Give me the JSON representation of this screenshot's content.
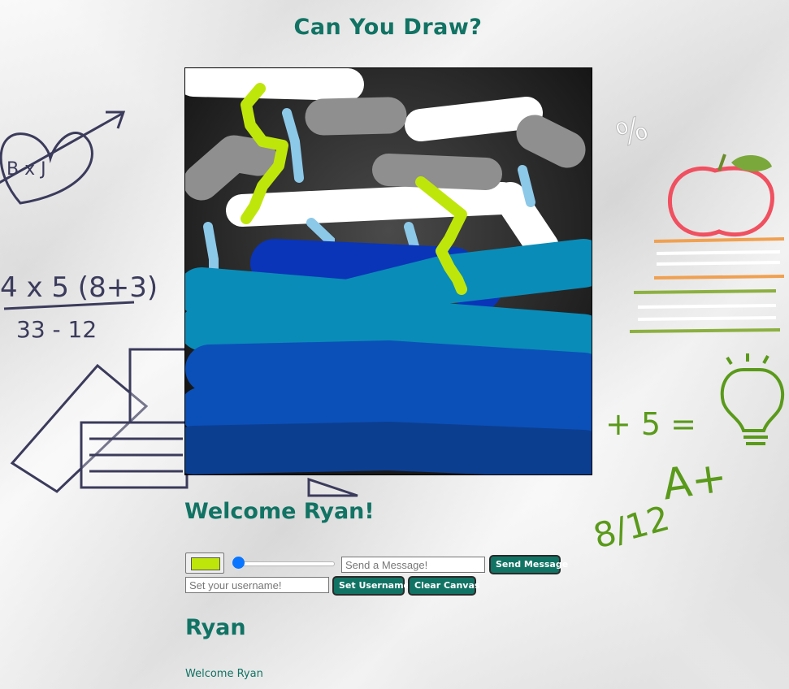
{
  "page": {
    "title": "Can You Draw?",
    "welcome_heading": "Welcome Ryan!",
    "username_heading": "Ryan"
  },
  "background": {
    "doodles": [
      "heart-doodle",
      "math-doodle",
      "books-doodle",
      "percent-doodle",
      "apple-doodle",
      "lightbulb-doodle",
      "grade-doodle"
    ],
    "heart_text": "B x J",
    "math_line1": "4 x 5 (8+3)",
    "math_line2": "33 - 12",
    "percent_text": "%",
    "equation_text": "+ 5 =",
    "grade_text": "A+",
    "fraction_text": "8/12"
  },
  "controls": {
    "brush_color": "#bfe60a",
    "brush_size_fraction": 0.05,
    "message_placeholder": "Send a Message!",
    "message_value": "",
    "send_message_label": "Send Message",
    "username_placeholder": "Set your username!",
    "username_value": "",
    "set_username_label": "Set Username",
    "clear_canvas_label": "Clear Canvas"
  },
  "messages": [
    {
      "text": "Welcome Ryan"
    }
  ],
  "colors": {
    "accent": "#117364",
    "canvas_bg": "#1c1c1c",
    "cloud_white": "#ffffff",
    "cloud_gray": "#8f8f8f",
    "lightning": "#bfe60a",
    "rain": "#8cc8e8",
    "wave_dark": "#0a35b8",
    "wave_mid": "#0a8cb8",
    "wave_blue": "#0b50b8",
    "wave_deep": "#0c3e90"
  }
}
